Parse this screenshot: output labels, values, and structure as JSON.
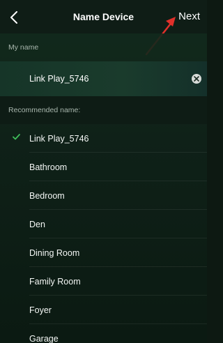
{
  "navbar": {
    "back_icon": "chevron-left-icon",
    "title": "Name Device",
    "next_label": "Next",
    "annotation_color": "#e0302a"
  },
  "my_name_section": {
    "header": "My name",
    "value": "Link Play_5746",
    "clear_icon": "clear-circle-icon"
  },
  "recommended_section": {
    "header": "Recommended name:",
    "check_color": "#3fbf5a",
    "items": [
      {
        "label": "Link Play_5746",
        "selected": true
      },
      {
        "label": "Bathroom",
        "selected": false
      },
      {
        "label": "Bedroom",
        "selected": false
      },
      {
        "label": "Den",
        "selected": false
      },
      {
        "label": "Dining Room",
        "selected": false
      },
      {
        "label": "Family Room",
        "selected": false
      },
      {
        "label": "Foyer",
        "selected": false
      },
      {
        "label": "Garage",
        "selected": false
      }
    ]
  }
}
